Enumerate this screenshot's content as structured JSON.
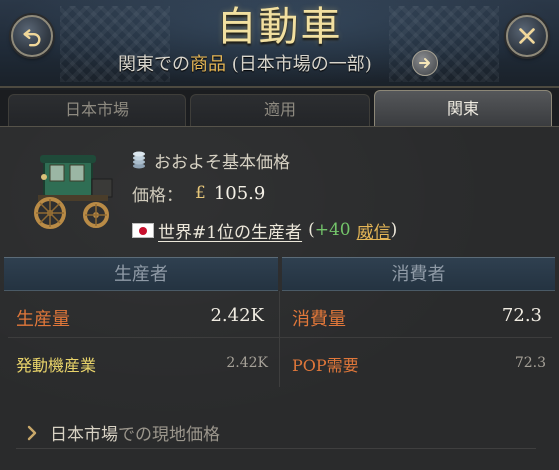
{
  "header": {
    "title": "自動車",
    "subtitle_prefix": "関東での",
    "subtitle_highlight": "商品",
    "subtitle_suffix": " (日本市場の一部)"
  },
  "tabs": [
    {
      "label": "日本市場",
      "active": false
    },
    {
      "label": "適用",
      "active": false
    },
    {
      "label": "関東",
      "active": true
    }
  ],
  "info": {
    "base_price_label": "おおよそ基本価格",
    "price_label": "価格：",
    "currency_symbol": "£",
    "price_value": "105.9",
    "world_rank_text": "世界#1位の生産者",
    "paren_open": "(",
    "prestige_value": "+40",
    "prestige_label": "威信",
    "paren_close": ")"
  },
  "producer": {
    "header": "生産者",
    "total_label": "生産量",
    "total_value": "2.42K",
    "items": [
      {
        "label": "発動機産業",
        "value": "2.42K"
      }
    ]
  },
  "consumer": {
    "header": "消費者",
    "total_label": "消費量",
    "total_value": "72.3",
    "items": [
      {
        "label": "POP需要",
        "value": "72.3"
      }
    ]
  },
  "local_price": {
    "market": "日本市場",
    "rest": "での現地価格"
  },
  "colors": {
    "title": "#f2e0a0",
    "highlight": "#e5b656",
    "orange_label": "#e0773a",
    "positive": "#73c46a",
    "header_band": "#2f4050"
  },
  "icons": {
    "back": "undo-arrow-icon",
    "close": "close-icon",
    "navigate": "arrow-right-icon",
    "coin": "coin-stack-icon",
    "flag": "japan-flag-icon",
    "good": "carriage-icon",
    "expand": "chevron-right-icon"
  }
}
